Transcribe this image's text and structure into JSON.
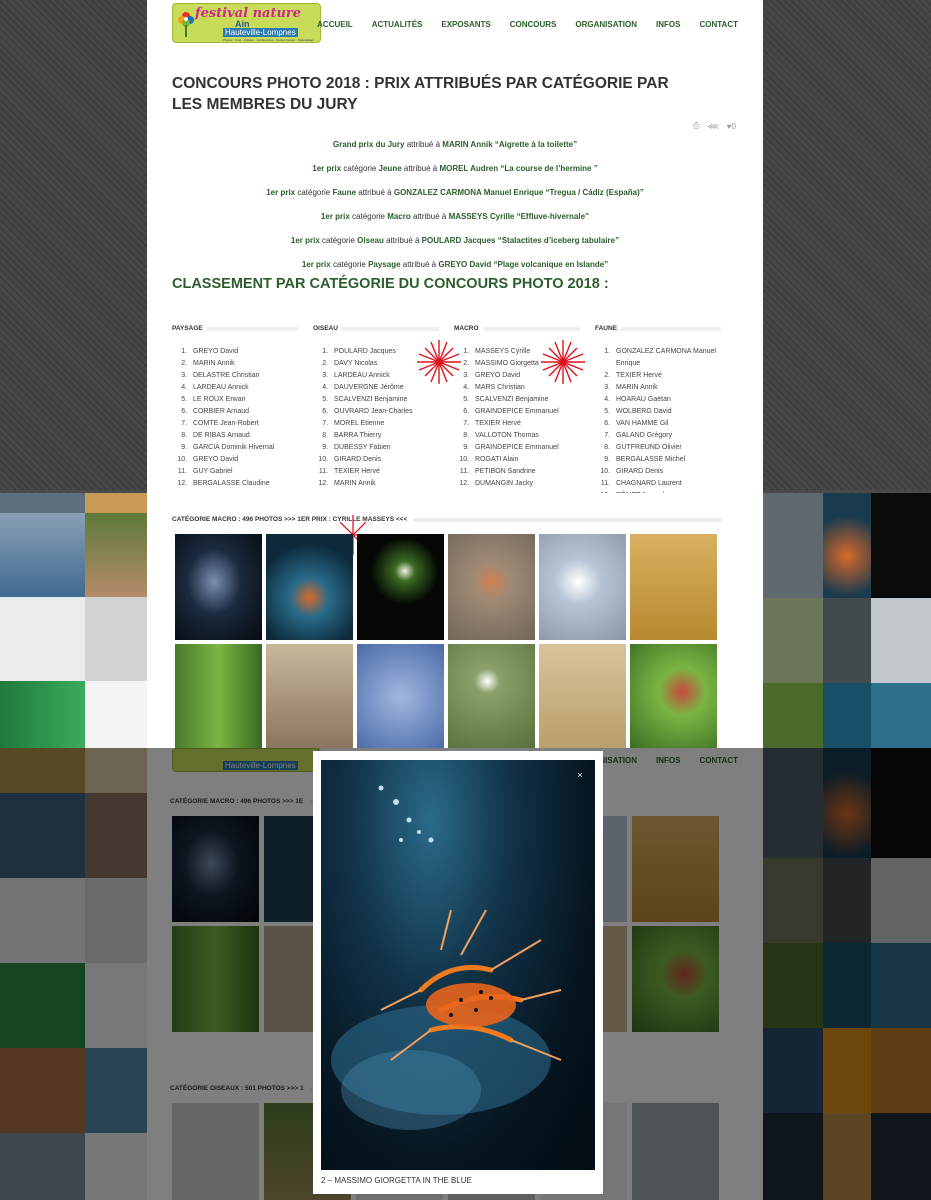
{
  "logo": {
    "title": "festival nature",
    "region": "Ain",
    "town": "Hauteville-Lompnes",
    "tagline": "Photos · Ciné · Artistes · Conférences · Sorties Nature · Naturalistes"
  },
  "nav": [
    "ACCUEIL",
    "ACTUALITÉS",
    "EXPOSANTS",
    "CONCOURS",
    "ORGANISATION",
    "INFOS",
    "CONTACT"
  ],
  "nav2": [
    "ORGANISATION",
    "INFOS",
    "CONTACT"
  ],
  "page_title": "CONCOURS PHOTO 2018 : PRIX ATTRIBUÉS PAR CATÉGORIE PAR LES MEMBRES DU JURY",
  "share": {
    "likes": "0"
  },
  "prizes": [
    {
      "a": "Grand prix du Jury",
      "b": " attribué à ",
      "c": "MARIN Annik “Aigrette à la toilette”",
      "d": "",
      "e": "",
      "f": ""
    },
    {
      "a": "1er prix",
      "b": " catégorie ",
      "c": "Jeune",
      "d": " attribué à ",
      "e": "MOREL Audren “La course de l’hermine ”",
      "f": ""
    },
    {
      "a": "1er prix",
      "b": " catégorie ",
      "c": "Faune",
      "d": " attribué à ",
      "e": "GONZALEZ CARMONA Manuel Enrique  “Tregua /  Cádiz (España)”",
      "f": ""
    },
    {
      "a": "1er prix",
      "b": " catégorie ",
      "c": "Macro",
      "d": " attribué à ",
      "e": "MASSEYS Cyrille “Effluve-hivernale”",
      "f": ""
    },
    {
      "a": "1er prix",
      "b": " catégorie ",
      "c": "Oiseau",
      "d": " attribué à ",
      "e": "POULARD Jacques “Stalactites d’iceberg tabulaire”",
      "f": ""
    },
    {
      "a": "1er prix",
      "b": " catégorie ",
      "c": "Paysage",
      "d": " attribué à ",
      "e": "GREYO David “Plage volcanique en Islande”",
      "f": ""
    }
  ],
  "classement_title": "CLASSEMENT PAR CATÉGORIE DU CONCOURS PHOTO 2018 :",
  "categories": [
    {
      "name": "PAYSAGE",
      "items": [
        "GREYO David",
        "MARIN Annik",
        "DELASTRE Christian",
        "LARDEAU Annick",
        "LE ROUX Erwan",
        "CORBIER Arnaud",
        "COMTE Jean-Robert",
        "DE RIBAS Arnaud",
        "GARCIA Dominik Hivernal",
        "GREYO David",
        "GUY Gabriel",
        "BERGALASSE Claudine"
      ]
    },
    {
      "name": "OISEAU",
      "items": [
        "POULARD Jacques",
        "DAVY Nicolas",
        "LARDEAU Annick",
        "DAUVERGNE Jérôme",
        "SCALVENZI Benjamine",
        "OUVRARD Jean-Charles",
        "MOREL Etienne",
        "BARRA Thierry",
        "DUBESSY Fabien",
        "GIRARD Denis",
        "TEXIER Hervé",
        "MARIN Annik"
      ]
    },
    {
      "name": "MACRO",
      "items": [
        "MASSEYS Cyrille",
        "MASSIMO Giorgetta",
        "GREYO David",
        "MARS Christian",
        "SCALVENZI Benjamine",
        "GRAINDEPICE Emmanuel",
        "TEXIER Hervé",
        "VALLOTON Thomas",
        "GRAINDEPICE Emmanuel",
        "ROGATI Alain",
        "PETIBON Sandrine",
        "DUMANGIN Jacky"
      ]
    },
    {
      "name": "FAUNE",
      "items": [
        "GONZALEZ CARMONA Manuel Enrique",
        "TEXIER Hervé",
        "MARIN Annik",
        "HOARAU Gaëtan",
        "WOLBERG David",
        "VAN HAMME Gil",
        "GALAND Grégory",
        "GUTFREUND Olivier",
        "BERGALASSE Michel",
        "GIRARD Denis",
        "CHAGNARD Laurent",
        "RÉMET Arnaud"
      ]
    }
  ],
  "macro_header": "CATÉGORIE MACRO : 496 PHOTOS >>> 1ER PRIX : CYRILLE MASSEYS <<<",
  "macro_header_2": "CATÉGORIE MACRO : 496 PHOTOS >>> 1E",
  "oiseaux_header": "CATÉGORIE OISEAUX : 501 PHOTOS >>> 1",
  "lightbox": {
    "close": "×",
    "caption": "2 – MASSIMO GIORGETTA IN THE BLUE"
  },
  "photo_colors": [
    "#0d1a2a",
    "#1d3f55",
    "#0a0f0c",
    "#8a7a68",
    "#b6c4d6",
    "#c9a14a",
    "#5f9a3c",
    "#b8a68e",
    "#6c86b8",
    "#7c9560",
    "#c9b58a",
    "#6e9b52"
  ],
  "tile_colors_left": [
    "#3a5f80",
    "#6a8a5a",
    "#e8ecee",
    "#cfd3d6",
    "#2d8a48",
    "#f3f3f3",
    "#b09a78",
    "#e2d6bc"
  ],
  "tile_colors_right": [
    "#1e3a4a",
    "#0c0c0c",
    "#6a7a5a",
    "#c4ccd2",
    "#3d5a2e",
    "#2c6a8a"
  ]
}
